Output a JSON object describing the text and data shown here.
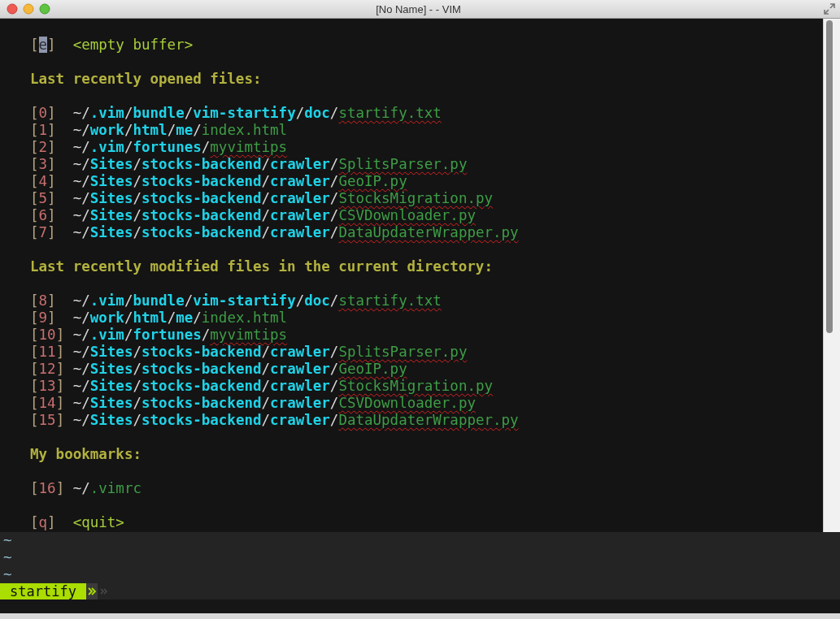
{
  "window": {
    "title": "[No Name] - - VIM"
  },
  "sections": [
    {
      "entries": [
        {
          "kind": "special",
          "index": "[e]",
          "label": "<empty buffer>",
          "cursor": true
        }
      ]
    },
    {
      "heading": "Last recently opened files:",
      "entries": [
        {
          "kind": "file",
          "index": "[0]",
          "dir": "~/.vim/bundle/vim-startify/doc/",
          "file": "startify.txt",
          "spell_error": true
        },
        {
          "kind": "file",
          "index": "[1]",
          "dir": "~/work/html/me/",
          "file": "index.html",
          "spell_error": false
        },
        {
          "kind": "file",
          "index": "[2]",
          "dir": "~/.vim/fortunes/",
          "file": "myvimtips",
          "spell_error": true
        },
        {
          "kind": "file",
          "index": "[3]",
          "dir": "~/Sites/stocks-backend/crawler/",
          "file": "SplitsParser.py",
          "spell_error": true
        },
        {
          "kind": "file",
          "index": "[4]",
          "dir": "~/Sites/stocks-backend/crawler/",
          "file": "GeoIP.py",
          "spell_error": true
        },
        {
          "kind": "file",
          "index": "[5]",
          "dir": "~/Sites/stocks-backend/crawler/",
          "file": "StocksMigration.py",
          "spell_error": true
        },
        {
          "kind": "file",
          "index": "[6]",
          "dir": "~/Sites/stocks-backend/crawler/",
          "file": "CSVDownloader.py",
          "spell_error": true
        },
        {
          "kind": "file",
          "index": "[7]",
          "dir": "~/Sites/stocks-backend/crawler/",
          "file": "DataUpdaterWrapper.py",
          "spell_error": true
        }
      ]
    },
    {
      "heading": "Last recently modified files in the current directory:",
      "entries": [
        {
          "kind": "file",
          "index": "[8]",
          "dir": "~/.vim/bundle/vim-startify/doc/",
          "file": "startify.txt",
          "spell_error": true
        },
        {
          "kind": "file",
          "index": "[9]",
          "dir": "~/work/html/me/",
          "file": "index.html",
          "spell_error": false
        },
        {
          "kind": "file",
          "index": "[10]",
          "dir": "~/.vim/fortunes/",
          "file": "myvimtips",
          "spell_error": true
        },
        {
          "kind": "file",
          "index": "[11]",
          "dir": "~/Sites/stocks-backend/crawler/",
          "file": "SplitsParser.py",
          "spell_error": true
        },
        {
          "kind": "file",
          "index": "[12]",
          "dir": "~/Sites/stocks-backend/crawler/",
          "file": "GeoIP.py",
          "spell_error": true
        },
        {
          "kind": "file",
          "index": "[13]",
          "dir": "~/Sites/stocks-backend/crawler/",
          "file": "StocksMigration.py",
          "spell_error": true
        },
        {
          "kind": "file",
          "index": "[14]",
          "dir": "~/Sites/stocks-backend/crawler/",
          "file": "CSVDownloader.py",
          "spell_error": true
        },
        {
          "kind": "file",
          "index": "[15]",
          "dir": "~/Sites/stocks-backend/crawler/",
          "file": "DataUpdaterWrapper.py",
          "spell_error": true
        }
      ]
    },
    {
      "heading": "My bookmarks:",
      "entries": [
        {
          "kind": "file",
          "index": "[16]",
          "dir": "~/",
          "file": ".vimrc",
          "spell_error": false
        }
      ]
    },
    {
      "entries": [
        {
          "kind": "special",
          "index": "[q]",
          "label": "<quit>",
          "cursor": false
        }
      ]
    }
  ],
  "tilde_lines": [
    "~",
    "~",
    "~"
  ],
  "status_line": {
    "mode": "startify"
  }
}
